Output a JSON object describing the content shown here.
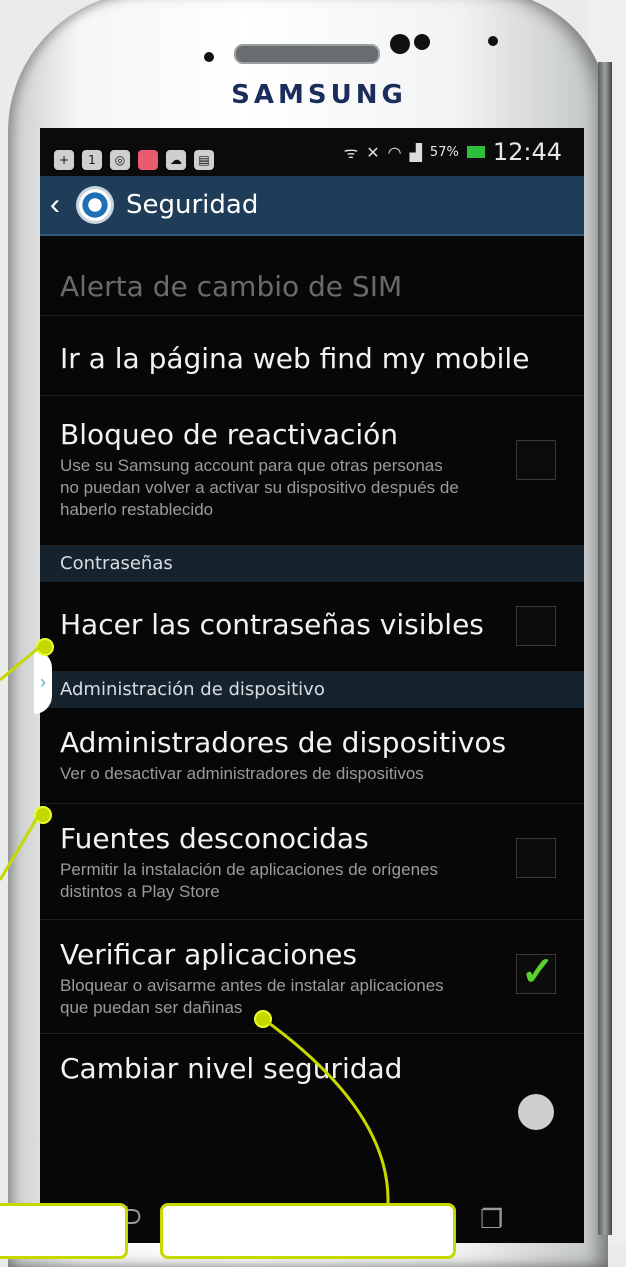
{
  "device": {
    "brand": "SAMSUNG"
  },
  "status_bar": {
    "battery": "57%",
    "time": "12:44"
  },
  "header": {
    "title": "Seguridad"
  },
  "items": [
    {
      "title": "Alerta de cambio de SIM",
      "enabled": false
    },
    {
      "title": "Ir a la página web find my mobile"
    },
    {
      "title": "Bloqueo de reactivación",
      "subtitle": "Use su Samsung account para que otras personas no puedan volver a activar su dispositivo después de haberlo restablecido",
      "checked": false
    }
  ],
  "sections": [
    {
      "label": "Contraseñas"
    },
    {
      "label": "Administración de dispositivo"
    }
  ],
  "passwords": {
    "title": "Hacer las contraseñas visibles",
    "checked": false
  },
  "admin_items": [
    {
      "title": "Administradores de dispositivos",
      "subtitle": "Ver o desactivar administradores de dispositivos"
    },
    {
      "title": "Fuentes desconocidas",
      "subtitle": "Permitir la instalación de aplicaciones de orígenes distintos a Play Store",
      "checked": false
    },
    {
      "title": "Verificar aplicaciones",
      "subtitle": "Bloquear o avisarme antes de instalar aplicaciones que puedan ser dañinas",
      "checked": true
    },
    {
      "title": "Cambiar nivel seguridad"
    }
  ],
  "colors": {
    "accent_green": "#c6d800",
    "action_bar": "#1f3d59"
  }
}
